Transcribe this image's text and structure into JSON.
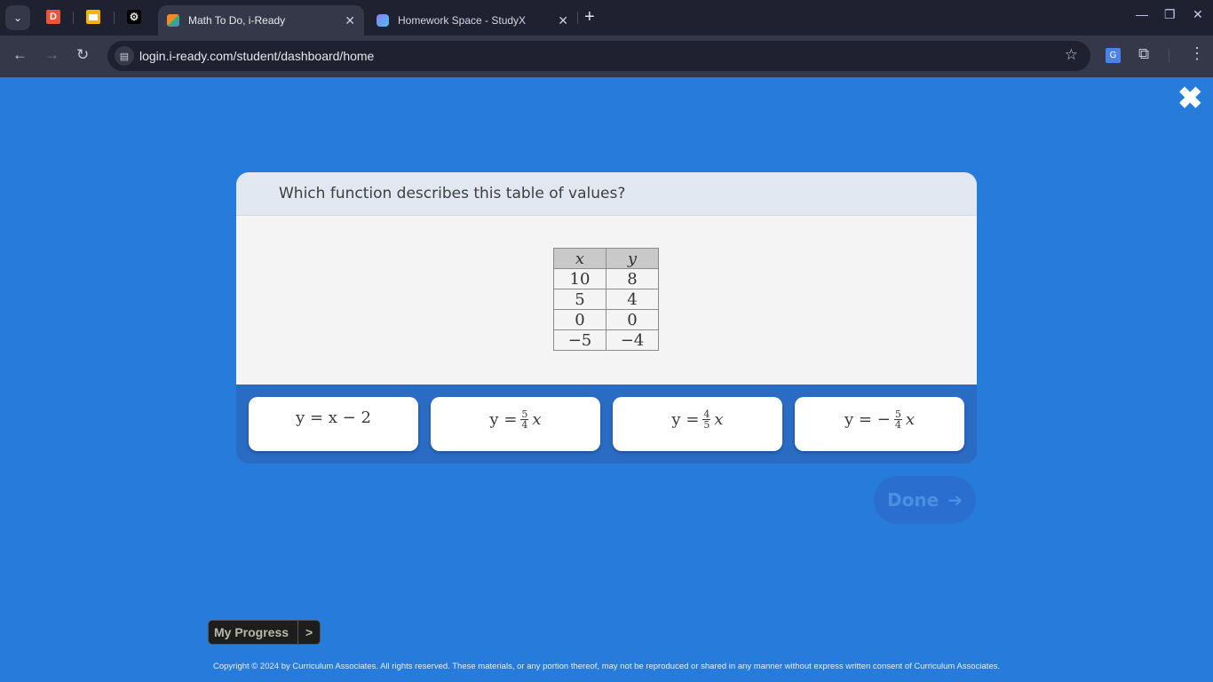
{
  "browser": {
    "tabs": [
      {
        "title": "Math To Do, i-Ready",
        "active": true
      },
      {
        "title": "Homework Space - StudyX",
        "active": false
      }
    ],
    "pinned_tabs": [
      {
        "icon": "d-app-icon",
        "letter": "D",
        "color": "#e8553b"
      },
      {
        "icon": "slides-icon",
        "color": "#f4b400"
      },
      {
        "icon": "openai-icon",
        "color": "#000000"
      }
    ],
    "close_glyph": "✕",
    "new_tab_glyph": "+",
    "url": "login.i-ready.com/student/dashboard/home",
    "window_controls": {
      "minimize": "—",
      "restore": "❐",
      "close": "✕"
    }
  },
  "page": {
    "close_glyph": "✖",
    "question": "Which function describes this table of values?",
    "table": {
      "headers": [
        "x",
        "y"
      ],
      "rows": [
        [
          "10",
          "8"
        ],
        [
          "5",
          "4"
        ],
        [
          "0",
          "0"
        ],
        [
          "−5",
          "−4"
        ]
      ]
    },
    "answers": [
      {
        "text": "y = x − 2"
      },
      {
        "prefix": "y =",
        "num": "5",
        "den": "4",
        "var": "x"
      },
      {
        "prefix": "y =",
        "num": "4",
        "den": "5",
        "var": "x"
      },
      {
        "prefix": "y = −",
        "num": "5",
        "den": "4",
        "var": "x"
      }
    ],
    "done_label": "Done",
    "done_arrow": "➔",
    "my_progress_label": "My Progress",
    "my_progress_chevron": ">",
    "copyright": "Copyright © 2024 by Curriculum Associates. All rights reserved. These materials, or any portion thereof, may not be reproduced or shared in any manner without express written consent of Curriculum Associates."
  },
  "colors": {
    "page_bg": "#277bdb",
    "card_header": "#e2e8f2",
    "answer_bg": "#ffffff"
  }
}
